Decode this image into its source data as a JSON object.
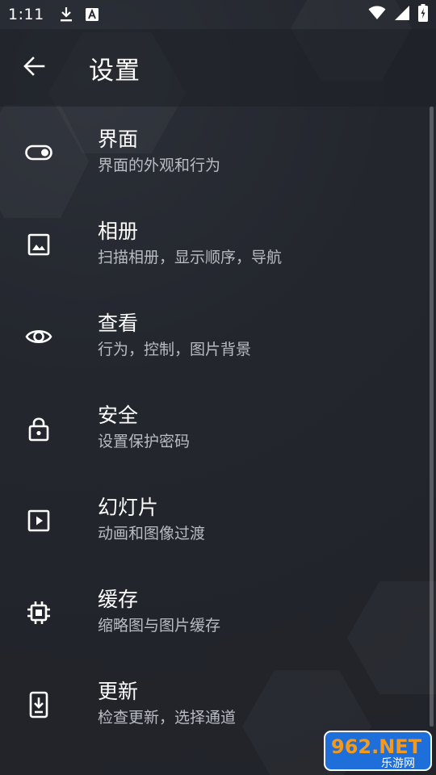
{
  "status_bar": {
    "time": "1:11",
    "icons": [
      "download-icon",
      "font-a-icon",
      "wifi-icon",
      "signal-icon",
      "battery-charging-icon"
    ]
  },
  "app_bar": {
    "back_icon": "arrow-back-icon",
    "title": "设置"
  },
  "settings": {
    "items": [
      {
        "icon": "toggle-icon",
        "title": "界面",
        "subtitle": "界面的外观和行为"
      },
      {
        "icon": "image-icon",
        "title": "相册",
        "subtitle": "扫描相册，显示顺序，导航"
      },
      {
        "icon": "eye-icon",
        "title": "查看",
        "subtitle": "行为，控制，图片背景"
      },
      {
        "icon": "lock-icon",
        "title": "安全",
        "subtitle": "设置保护密码"
      },
      {
        "icon": "slideshow-icon",
        "title": "幻灯片",
        "subtitle": "动画和图像过渡"
      },
      {
        "icon": "memory-chip-icon",
        "title": "缓存",
        "subtitle": "缩略图与图片缓存"
      },
      {
        "icon": "phone-download-icon",
        "title": "更新",
        "subtitle": "检查更新，选择通道"
      }
    ]
  },
  "watermark": {
    "brand": "962.NET",
    "caption": "乐游网"
  },
  "colors": {
    "background": "#23262d",
    "text_primary": "#ffffff",
    "text_secondary": "#b9bcc3",
    "watermark_blue": "#1e6fd9",
    "watermark_orange": "#f39a1e"
  }
}
